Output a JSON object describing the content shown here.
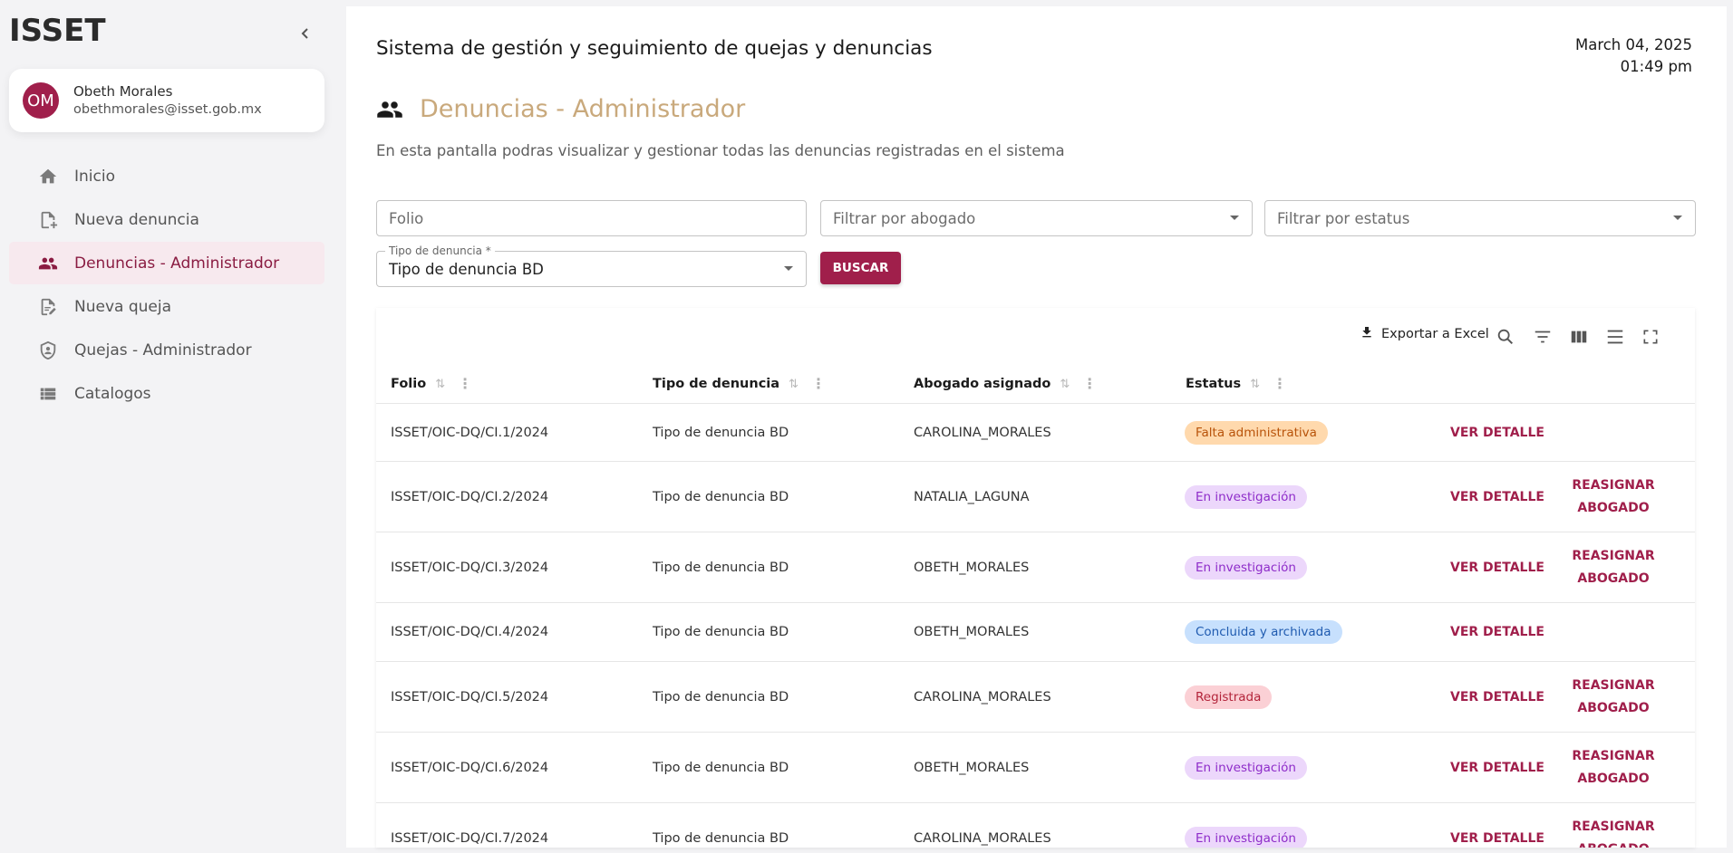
{
  "app": {
    "brand": "ISSET"
  },
  "user": {
    "initials": "OM",
    "name": "Obeth Morales",
    "email": "obethmorales@isset.gob.mx"
  },
  "sidebar": {
    "items": [
      {
        "label": "Inicio",
        "icon": "home-icon"
      },
      {
        "label": "Nueva denuncia",
        "icon": "file-add-icon"
      },
      {
        "label": "Denuncias - Administrador",
        "icon": "people-icon",
        "active": true
      },
      {
        "label": "Nueva queja",
        "icon": "edit-document-icon"
      },
      {
        "label": "Quejas - Administrador",
        "icon": "shield-person-icon"
      },
      {
        "label": "Catalogos",
        "icon": "list-icon"
      }
    ]
  },
  "header": {
    "system_title": "Sistema de gestión y seguimiento de quejas y denuncias",
    "date": "March 04, 2025",
    "time": "01:49 pm"
  },
  "page": {
    "title": "Denuncias - Administrador",
    "description": "En esta pantalla podras visualizar y gestionar todas las denuncias registradas en el sistema"
  },
  "filters": {
    "folio_placeholder": "Folio",
    "abogado_placeholder": "Filtrar por abogado",
    "estatus_placeholder": "Filtrar por estatus",
    "tipo_label": "Tipo de denuncia *",
    "tipo_value": "Tipo de denuncia BD",
    "search_button": "BUSCAR"
  },
  "toolbar": {
    "export_label": "Exportar a Excel"
  },
  "table": {
    "columns": [
      "Folio",
      "Tipo de denuncia",
      "Abogado asignado",
      "Estatus"
    ],
    "view_label": "VER DETALLE",
    "reassign_line1": "REASIGNAR",
    "reassign_line2": "ABOGADO",
    "rows": [
      {
        "folio": "ISSET/OIC-DQ/CI.1/2024",
        "tipo": "Tipo de denuncia BD",
        "abogado": "CAROLINA_MORALES",
        "estatus": "Falta administrativa",
        "status_kind": "falta",
        "reassign": false
      },
      {
        "folio": "ISSET/OIC-DQ/CI.2/2024",
        "tipo": "Tipo de denuncia BD",
        "abogado": "NATALIA_LAGUNA",
        "estatus": "En investigación",
        "status_kind": "invest",
        "reassign": true
      },
      {
        "folio": "ISSET/OIC-DQ/CI.3/2024",
        "tipo": "Tipo de denuncia BD",
        "abogado": "OBETH_MORALES",
        "estatus": "En investigación",
        "status_kind": "invest",
        "reassign": true
      },
      {
        "folio": "ISSET/OIC-DQ/CI.4/2024",
        "tipo": "Tipo de denuncia BD",
        "abogado": "OBETH_MORALES",
        "estatus": "Concluida y archivada",
        "status_kind": "concl",
        "reassign": false
      },
      {
        "folio": "ISSET/OIC-DQ/CI.5/2024",
        "tipo": "Tipo de denuncia BD",
        "abogado": "CAROLINA_MORALES",
        "estatus": "Registrada",
        "status_kind": "reg",
        "reassign": true
      },
      {
        "folio": "ISSET/OIC-DQ/CI.6/2024",
        "tipo": "Tipo de denuncia BD",
        "abogado": "OBETH_MORALES",
        "estatus": "En investigación",
        "status_kind": "invest",
        "reassign": true
      },
      {
        "folio": "ISSET/OIC-DQ/CI.7/2024",
        "tipo": "Tipo de denuncia BD",
        "abogado": "CAROLINA_MORALES",
        "estatus": "En investigación",
        "status_kind": "invest",
        "reassign": true
      }
    ]
  },
  "colors": {
    "accent": "#a01f4b",
    "title_gold": "#c9a97c",
    "active_bg": "#f7e9ee"
  }
}
